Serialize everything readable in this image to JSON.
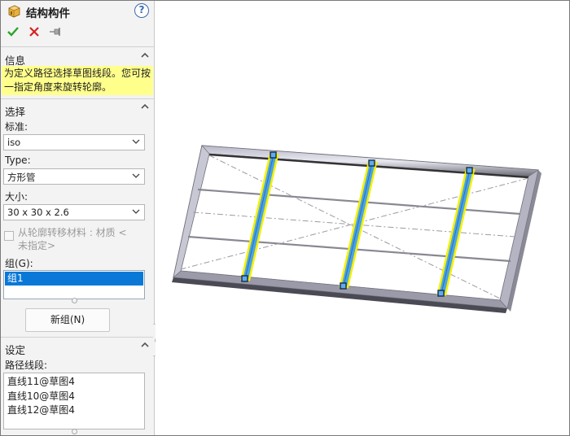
{
  "panel": {
    "title": "结构构件",
    "title_icon": "structural-member-icon",
    "help_label": "?",
    "actions": {
      "ok_icon": "checkmark-icon",
      "cancel_icon": "close-icon",
      "pin_icon": "pushpin-icon"
    }
  },
  "info": {
    "heading": "信息",
    "line1": "为定义路径选择草图线段。您可按",
    "line2": "一指定角度来旋转轮廓。"
  },
  "selection": {
    "heading": "选择",
    "standard_label": "标准:",
    "standard_value": "iso",
    "type_label": "Type:",
    "type_value": "方形管",
    "size_label": "大小:",
    "size_value": "30 x 30 x 2.6",
    "transfer_material_line1": "从轮廓转移材料 : 材质 <",
    "transfer_material_line2": "未指定>",
    "transfer_material_checked": false,
    "groups_label": "组(G):",
    "groups": [
      "组1"
    ],
    "new_group_button": "新组(N)"
  },
  "settings": {
    "heading": "设定",
    "path_segments_label": "路径线段:",
    "path_segments": [
      "直线11@草图4",
      "直线10@草图4",
      "直线12@草图4"
    ]
  },
  "colors": {
    "panel_bg": "#f3f3f3",
    "info_bg": "#ffff8c",
    "selection_highlight": "#0a78d7",
    "member_highlight": "#f5f000",
    "member_fill": "#4aa3e8"
  }
}
